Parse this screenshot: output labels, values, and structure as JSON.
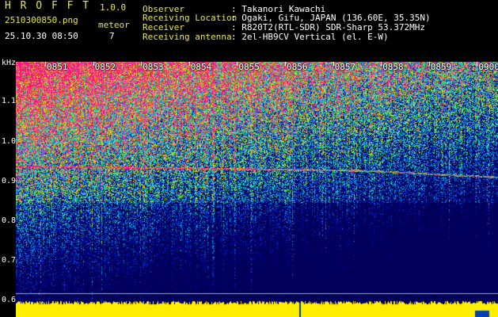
{
  "header": {
    "app_title": "H R O F F T",
    "version": "1.0.0",
    "filename": "2510300850.png",
    "timestamp": "25.10.30 08:50",
    "meteor_label": "meteor",
    "meteor_count": "7",
    "observer_label": "Observer",
    "observer_value": ": Takanori Kawachi",
    "location_label": "Receiving Location",
    "location_value": ": Ogaki, Gifu, JAPAN (136.60E, 35.35N)",
    "receiver_label": "Receiver",
    "receiver_value": ": R820T2(RTL-SDR) SDR-Sharp 53.372MHz",
    "antenna_label": "Receiving antenna",
    "antenna_value": ": 2el-HB9CV Vertical (el. E-W)"
  },
  "axis": {
    "unit": "kHz",
    "y_ticks": [
      "1.1",
      "1.0",
      "0.9",
      "0.8",
      "0.7",
      "0.6"
    ],
    "x_ticks": [
      "0851",
      "0852",
      "0853",
      "0854",
      "0855",
      "0856",
      "0857",
      "0858",
      "0859",
      "0900"
    ]
  },
  "colors": {
    "header_yellow": "#e8e83c",
    "text_white": "#ffffff",
    "bottom_band": "#ffee00"
  }
}
